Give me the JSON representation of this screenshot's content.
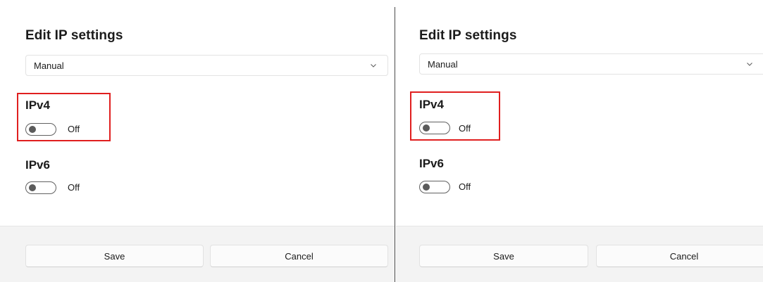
{
  "panels": [
    {
      "title": "Edit IP settings",
      "mode": {
        "selected": "Manual"
      },
      "ipv4": {
        "label": "IPv4",
        "state": "Off",
        "on": false
      },
      "ipv6": {
        "label": "IPv6",
        "state": "Off",
        "on": false
      },
      "footer": {
        "save_label": "Save",
        "cancel_label": "Cancel"
      }
    },
    {
      "title": "Edit IP settings",
      "mode": {
        "selected": "Manual"
      },
      "ipv4": {
        "label": "IPv4",
        "state": "Off",
        "on": false
      },
      "ipv6": {
        "label": "IPv6",
        "state": "Off",
        "on": false
      },
      "footer": {
        "save_label": "Save",
        "cancel_label": "Cancel"
      }
    }
  ],
  "colors": {
    "highlight": "#e01f1f",
    "footer_background": "#f3f3f3",
    "separator": "#4a4a4a"
  },
  "icons": {
    "dropdown": "chevron-down-icon"
  }
}
